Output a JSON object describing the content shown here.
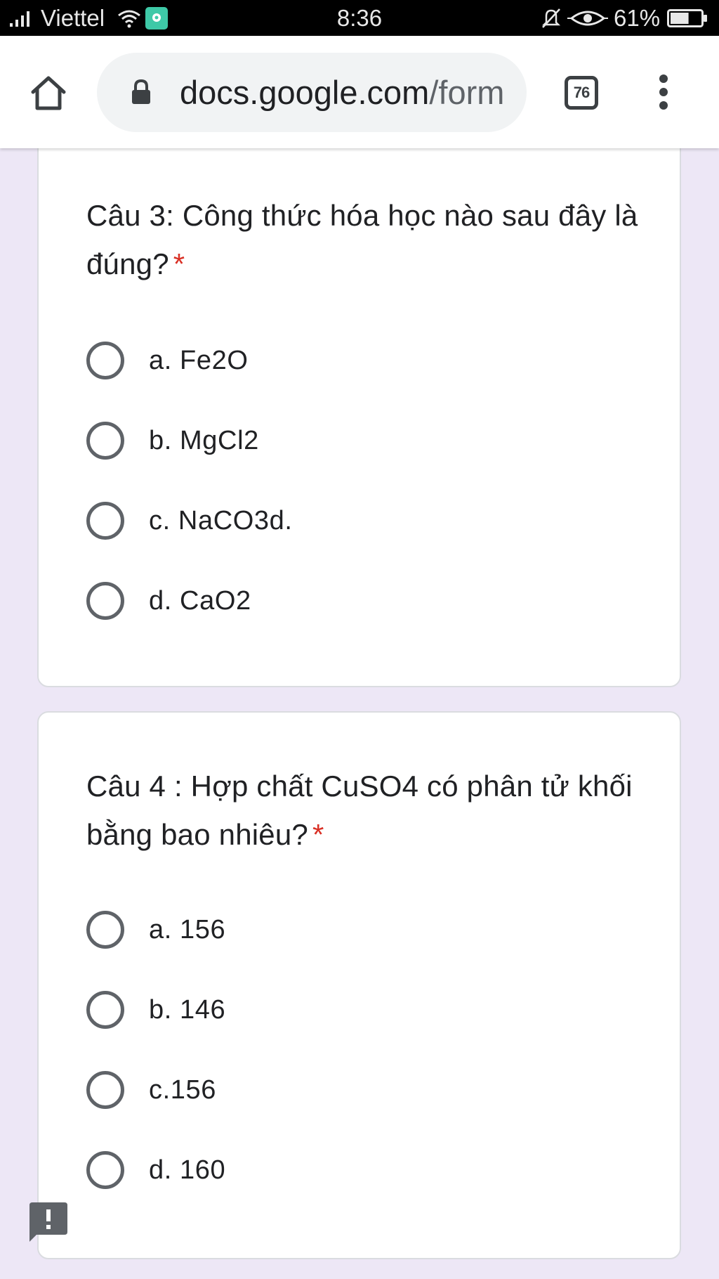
{
  "status_bar": {
    "carrier": "Viettel",
    "time": "8:36",
    "battery": "61%",
    "battery_level": 0.61
  },
  "browser": {
    "url_domain": "docs.google.com",
    "url_path": "/form",
    "tab_count": "76"
  },
  "questions": [
    {
      "title": "Câu 3: Công thức hóa học nào sau đây là đúng?",
      "required_mark": "*",
      "options": [
        "a. Fe2O",
        "b. MgCl2",
        "c. NaCO3d.",
        "d. CaO2"
      ]
    },
    {
      "title": "Câu 4 : Hợp chất CuSO4 có phân tử khối bằng bao nhiêu?",
      "required_mark": "*",
      "options": [
        "a. 156",
        "b. 146",
        "c.156",
        "d. 160"
      ]
    }
  ],
  "colors": {
    "page_background": "#ede7f6",
    "required": "#d93025",
    "radio_border": "#5f6368"
  }
}
